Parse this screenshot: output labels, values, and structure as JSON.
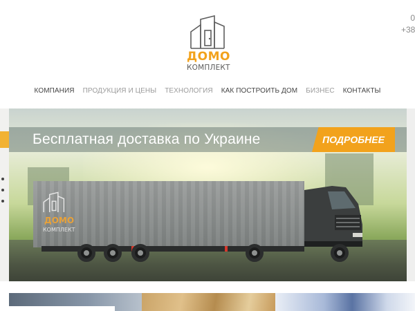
{
  "brand": {
    "name_top": "ДОМО",
    "name_bottom": "КОМПЛЕКТ",
    "accent_color": "#f2a21c"
  },
  "contact": {
    "line1": "0",
    "line2": "+38"
  },
  "nav": {
    "items": [
      {
        "label": "Компания",
        "tone": "dark"
      },
      {
        "label": "Продукция и цены",
        "tone": "light"
      },
      {
        "label": "Технология",
        "tone": "light"
      },
      {
        "label": "Как построить дом",
        "tone": "dark"
      },
      {
        "label": "Бизнес",
        "tone": "light"
      },
      {
        "label": "Контакты",
        "tone": "dark"
      }
    ]
  },
  "hero": {
    "headline": "Бесплатная доставка по Украине",
    "cta_label": "Подробнее",
    "truck_brand_top": "ДОМО",
    "truck_brand_bottom": "КОМПЛЕКТ"
  }
}
